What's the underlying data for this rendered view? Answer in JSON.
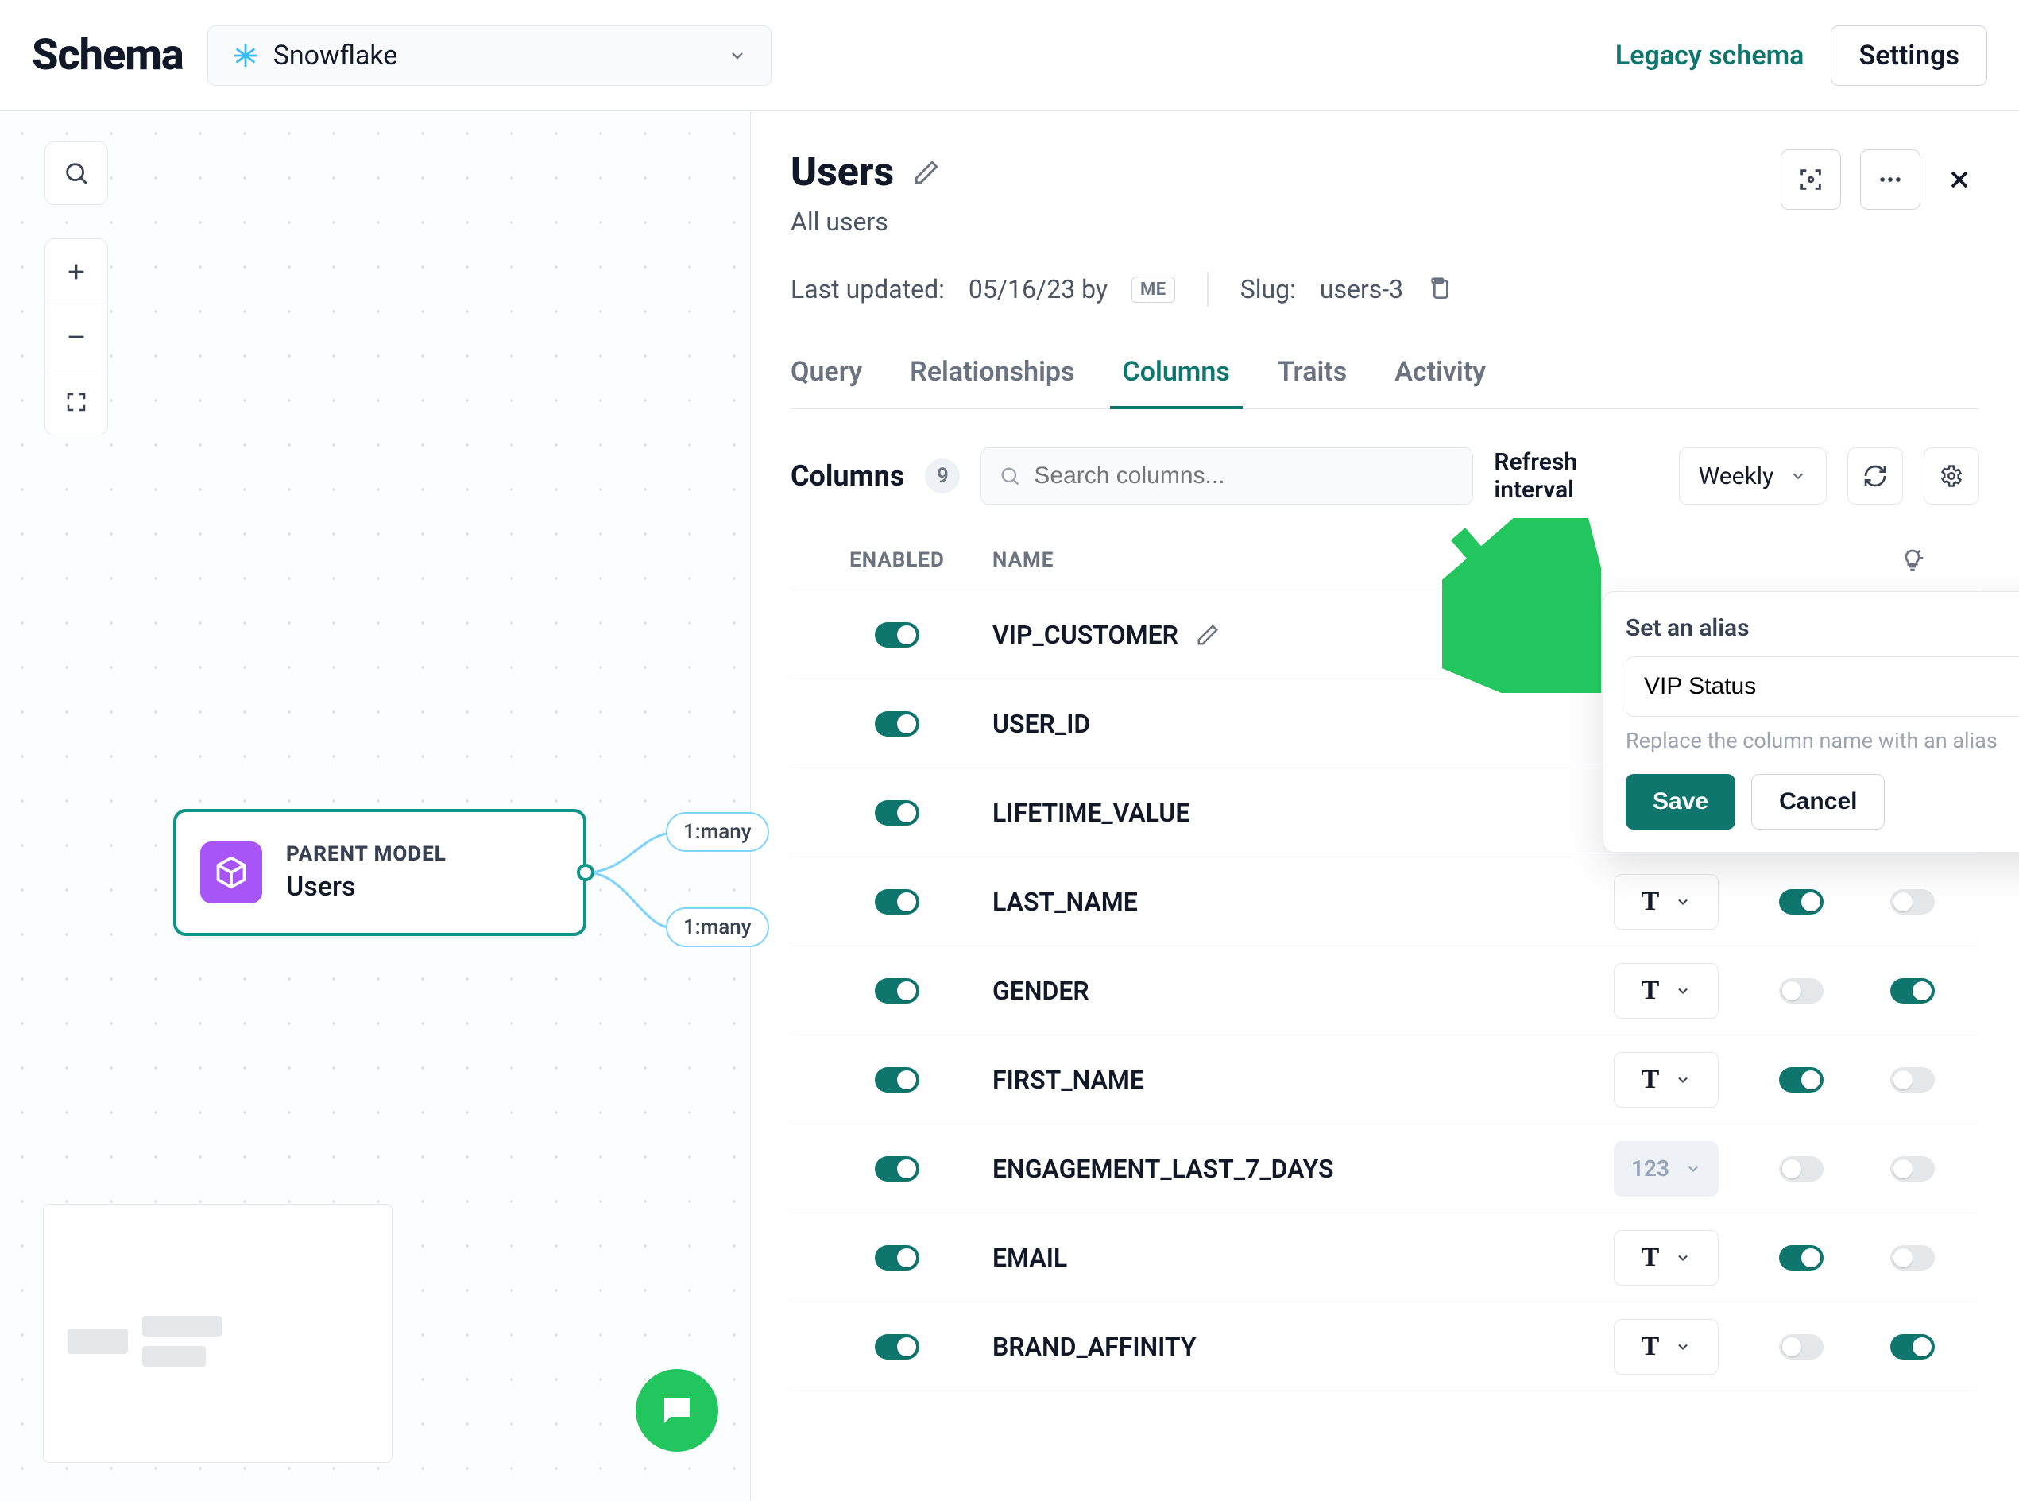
{
  "topbar": {
    "logo": "Schema",
    "source_label": "Snowflake",
    "legacy_link": "Legacy schema",
    "settings": "Settings"
  },
  "canvas": {
    "node": {
      "super": "PARENT MODEL",
      "name": "Users"
    },
    "edge_badge_1": "1:many",
    "edge_badge_2": "1:many"
  },
  "detail": {
    "title": "Users",
    "subtitle": "All users",
    "last_updated_label": "Last updated:",
    "last_updated_value": "05/16/23 by",
    "by_badge": "ME",
    "slug_label": "Slug:",
    "slug_value": "users-3",
    "tabs": {
      "query": "Query",
      "relationships": "Relationships",
      "columns": "Columns",
      "traits": "Traits",
      "activity": "Activity"
    },
    "columns_bar": {
      "title": "Columns",
      "count": "9",
      "search_placeholder": "Search columns...",
      "refresh_label": "Refresh interval",
      "refresh_value": "Weekly"
    },
    "table_headers": {
      "enabled": "ENABLED",
      "name": "NAME"
    },
    "columns": [
      {
        "name": "VIP_CUSTOMER",
        "type": null,
        "t1": false,
        "t2": false,
        "edit": true
      },
      {
        "name": "USER_ID",
        "type": null,
        "t1": false,
        "t2": false,
        "edit": false
      },
      {
        "name": "LIFETIME_VALUE",
        "type": "num",
        "t1": false,
        "t2": false,
        "edit": false
      },
      {
        "name": "LAST_NAME",
        "type": "txt",
        "t1": true,
        "t2": false,
        "edit": false
      },
      {
        "name": "GENDER",
        "type": "txt",
        "t1": false,
        "t2": true,
        "edit": false
      },
      {
        "name": "FIRST_NAME",
        "type": "txt",
        "t1": true,
        "t2": false,
        "edit": false
      },
      {
        "name": "ENGAGEMENT_LAST_7_DAYS",
        "type": "num",
        "t1": false,
        "t2": false,
        "edit": false
      },
      {
        "name": "EMAIL",
        "type": "txt",
        "t1": true,
        "t2": false,
        "edit": false
      },
      {
        "name": "BRAND_AFFINITY",
        "type": "txt",
        "t1": false,
        "t2": true,
        "edit": false
      }
    ]
  },
  "popover": {
    "title": "Set an alias",
    "value": "VIP Status",
    "help": "Replace the column name with an alias",
    "save": "Save",
    "cancel": "Cancel"
  },
  "type_labels": {
    "txt": "T",
    "num": "123"
  }
}
